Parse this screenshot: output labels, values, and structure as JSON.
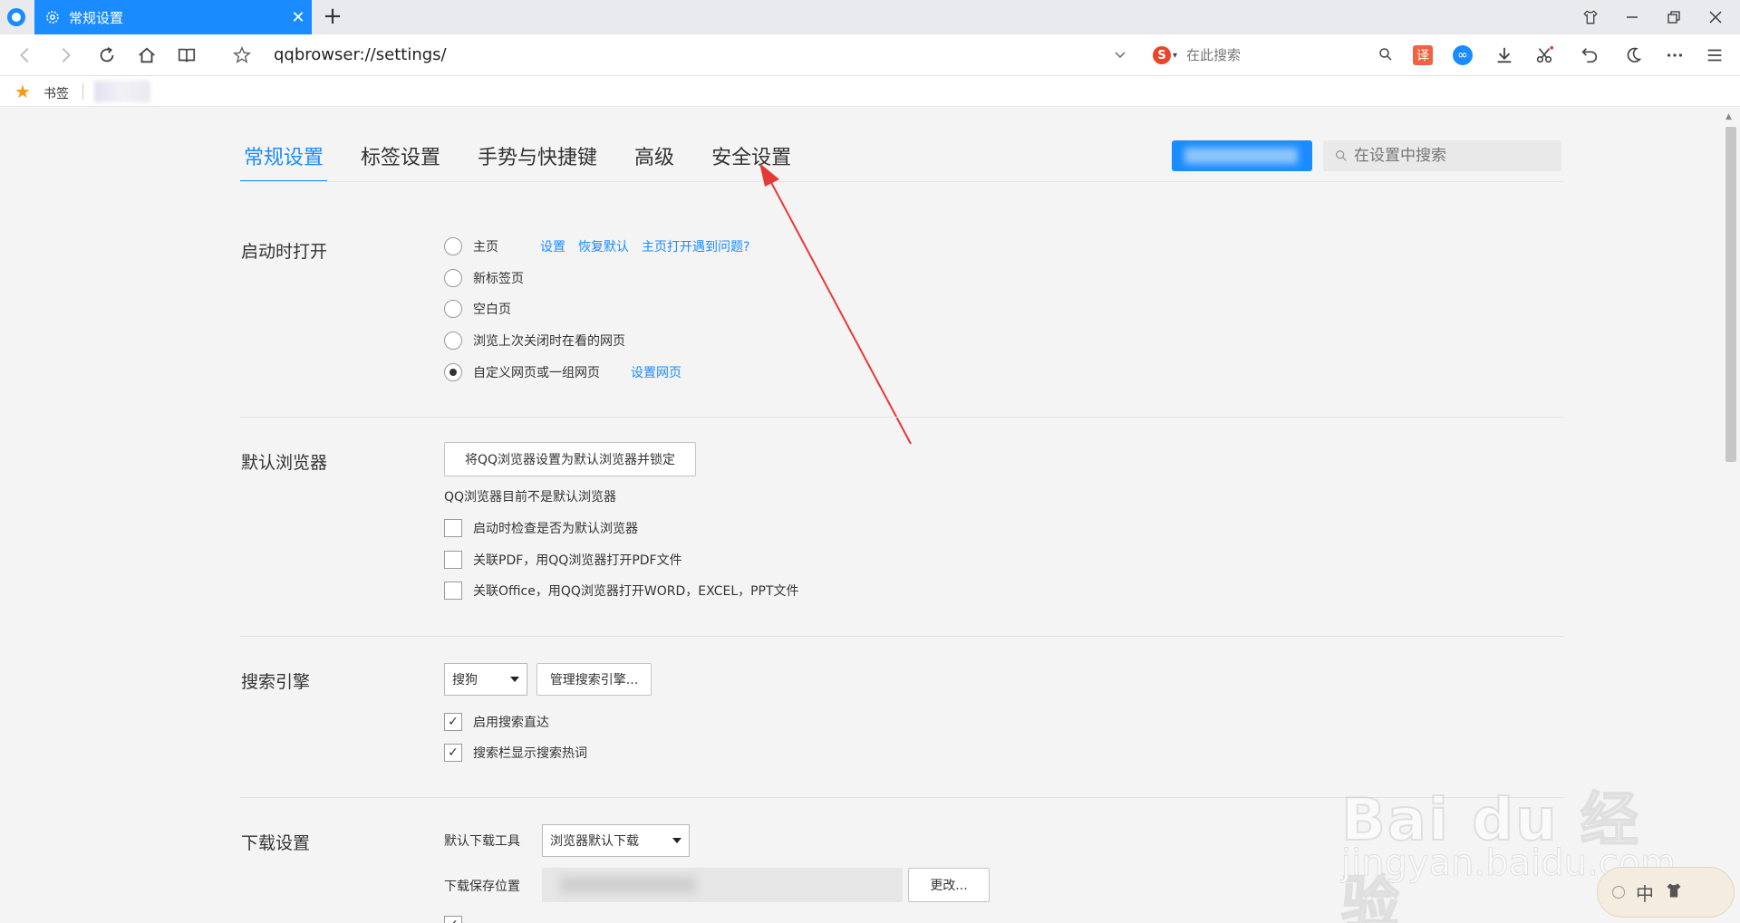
{
  "tab": {
    "title": "常规设置"
  },
  "toolbar": {
    "address": "qqbrowser://settings/",
    "search_placeholder": "在此搜索",
    "search_engine_logo": "S",
    "translate_label": "译"
  },
  "bookmarks": {
    "label": "书签"
  },
  "settings_nav": {
    "tabs": [
      "常规设置",
      "标签设置",
      "手势与快捷键",
      "高级",
      "安全设置"
    ],
    "search_placeholder": "在设置中搜索"
  },
  "startup": {
    "title": "启动时打开",
    "options": [
      "主页",
      "新标签页",
      "空白页",
      "浏览上次关闭时在看的网页",
      "自定义网页或一组网页"
    ],
    "selected": 4,
    "home_links": [
      "设置",
      "恢复默认",
      "主页打开遇到问题?"
    ],
    "custom_link": "设置网页"
  },
  "default_browser": {
    "title": "默认浏览器",
    "button": "将QQ浏览器设置为默认浏览器并锁定",
    "status": "QQ浏览器目前不是默认浏览器",
    "checks": [
      "启动时检查是否为默认浏览器",
      "关联PDF，用QQ浏览器打开PDF文件",
      "关联Office，用QQ浏览器打开WORD，EXCEL，PPT文件"
    ]
  },
  "search_engine": {
    "title": "搜索引擎",
    "selected": "搜狗",
    "manage_button": "管理搜索引擎...",
    "checks": [
      "启用搜索直达",
      "搜索栏显示搜索热词"
    ]
  },
  "download": {
    "title": "下载设置",
    "tool_label": "默认下载工具",
    "tool_value": "浏览器默认下载",
    "location_label": "下载保存位置",
    "change_button": "更改..."
  },
  "watermark": {
    "brand": "Bai du 经验",
    "url": "jingyan.baidu.com"
  },
  "ime": {
    "label": "中"
  },
  "colors": {
    "accent": "#1a8cff",
    "annotation_arrow": "#e53935"
  }
}
